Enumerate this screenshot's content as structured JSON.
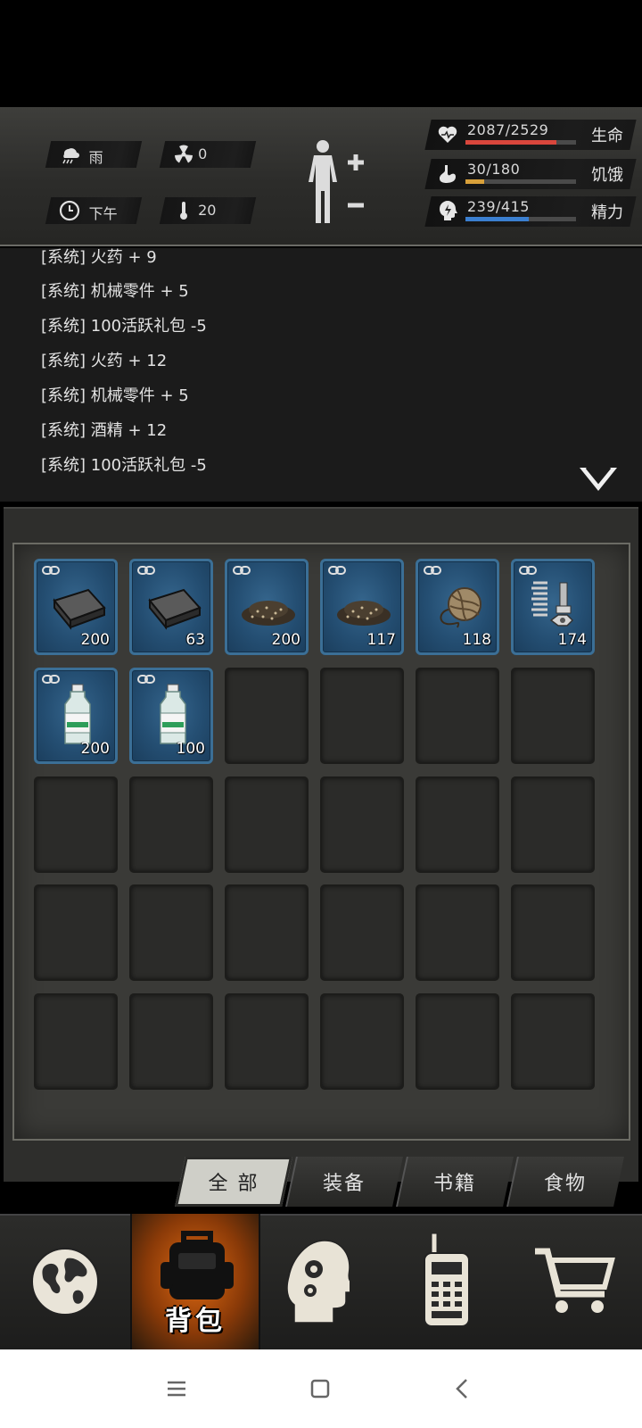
{
  "status": {
    "weather": "雨",
    "radiation": "0",
    "time_of_day": "下午",
    "temperature": "20",
    "stats": [
      {
        "label": "生命",
        "text": "2087/2529",
        "current": 2087,
        "max": 2529,
        "color": "#d9463c"
      },
      {
        "label": "饥饿",
        "text": "30/180",
        "current": 30,
        "max": 180,
        "color": "#d8a03a"
      },
      {
        "label": "精力",
        "text": "239/415",
        "current": 239,
        "max": 415,
        "color": "#3b7fd0"
      }
    ]
  },
  "log": [
    "[系统] 火药 + 9",
    "[系统] 机械零件 + 5",
    "[系统] 100活跃礼包 -5",
    "[系统] 火药 + 12",
    "[系统] 机械零件 + 5",
    "[系统] 酒精 + 12",
    "[系统] 100活跃礼包 -5"
  ],
  "inventory": {
    "items": [
      {
        "icon": "metal-bar-icon",
        "qty": "200"
      },
      {
        "icon": "metal-bar-icon",
        "qty": "63"
      },
      {
        "icon": "gunpowder-pile-icon",
        "qty": "200"
      },
      {
        "icon": "gunpowder-pile-icon",
        "qty": "117"
      },
      {
        "icon": "rope-ball-icon",
        "qty": "118"
      },
      {
        "icon": "spring-bolt-icon",
        "qty": "174"
      },
      {
        "icon": "alcohol-bottle-icon",
        "qty": "200"
      },
      {
        "icon": "alcohol-bottle-icon",
        "qty": "100"
      }
    ],
    "total_slots": 30
  },
  "tabs": [
    "全 部",
    "装备",
    "书籍",
    "食物"
  ],
  "nav": {
    "items": [
      "globe-icon",
      "backpack-icon",
      "brain-gears-icon",
      "radio-icon",
      "cart-icon"
    ],
    "bag_label": "背包"
  },
  "colors": {
    "slot_blue": "#2a5a82",
    "active_nav": "#e06a12"
  }
}
